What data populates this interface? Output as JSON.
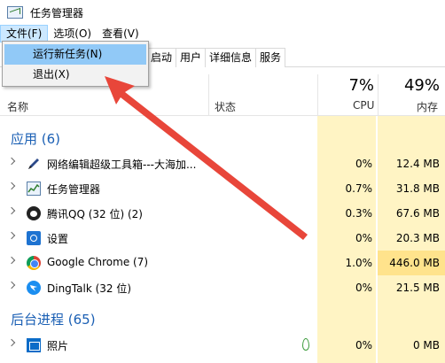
{
  "title": "任务管理器",
  "menus": [
    {
      "label": "文件(F)",
      "active": true
    },
    {
      "label": "选项(O)"
    },
    {
      "label": "查看(V)"
    }
  ],
  "dropdown": [
    {
      "label": "运行新任务(N)",
      "highlighted": true
    },
    {
      "label": "退出(X)"
    }
  ],
  "tabs": [
    "启动",
    "用户",
    "详细信息",
    "服务"
  ],
  "header": {
    "name": "名称",
    "status": "状态",
    "cpu_pct": "7%",
    "cpu": "CPU",
    "mem_pct": "49%",
    "mem": "内存"
  },
  "groups": {
    "apps": "应用 (6)",
    "background": "后台进程 (65)"
  },
  "rows": [
    {
      "icon": "pen-icon",
      "name": "网络编辑超级工具箱---大海加...",
      "cpu": "0%",
      "mem": "12.4 MB"
    },
    {
      "icon": "task-manager-icon",
      "name": "任务管理器",
      "cpu": "0.7%",
      "mem": "31.8 MB"
    },
    {
      "icon": "qq-icon",
      "name": "腾讯QQ (32 位) (2)",
      "cpu": "0.3%",
      "mem": "67.6 MB"
    },
    {
      "icon": "settings-icon",
      "name": "设置",
      "cpu": "0%",
      "mem": "20.3 MB"
    },
    {
      "icon": "chrome-icon",
      "name": "Google Chrome (7)",
      "cpu": "1.0%",
      "mem": "446.0 MB",
      "mem_hot": true
    },
    {
      "icon": "dingtalk-icon",
      "name": "DingTalk (32 位)",
      "cpu": "0%",
      "mem": "21.5 MB"
    }
  ],
  "bg_rows": [
    {
      "icon": "photos-icon",
      "name": "照片",
      "status_icon": "leaf-icon",
      "cpu": "0%",
      "mem": "0 MB"
    }
  ],
  "colors": {
    "highlight": "#91c9f7",
    "group_text": "#1a5fb4",
    "usage_light": "#fff4c4",
    "usage_hot": "#ffe38c",
    "arrow": "#e8463a"
  }
}
